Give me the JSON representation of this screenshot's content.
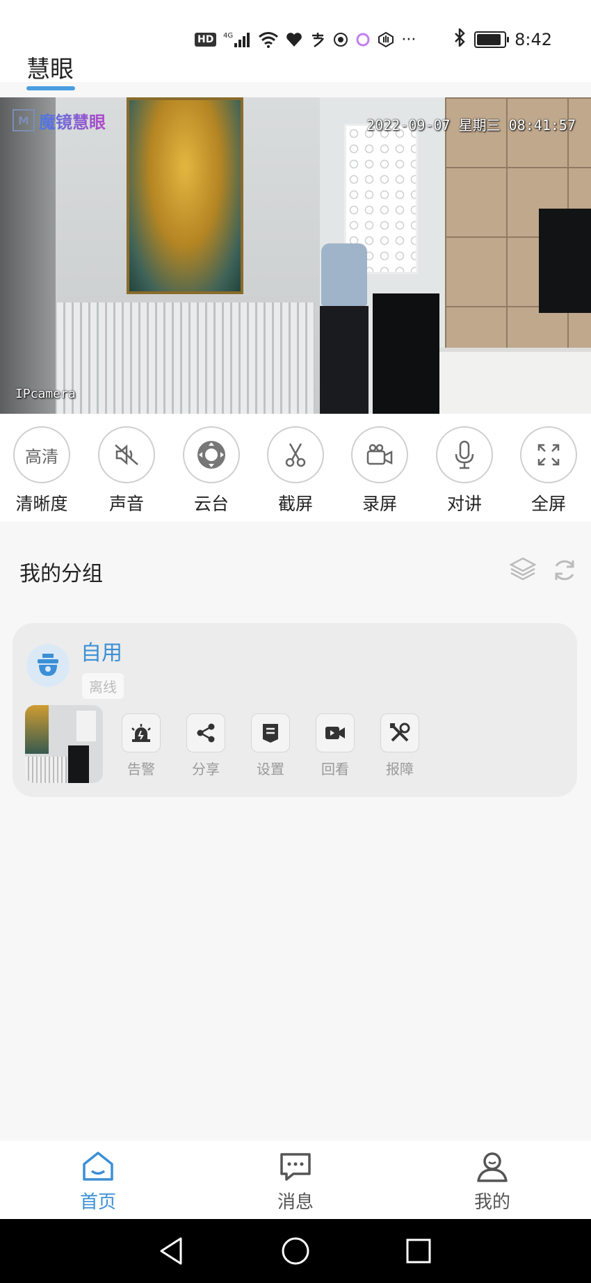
{
  "status_bar": {
    "left_icons": [
      "hd-icon",
      "4g-signal-icon",
      "wifi-icon",
      "health-icon",
      "alipay-icon",
      "sf-icon",
      "circle-app-icon",
      "gesture-icon",
      "more-dots-icon"
    ],
    "hd_label": "HD",
    "network_label": "4G",
    "more_label": "···",
    "time": "8:42",
    "battery_level": 0.9
  },
  "header": {
    "title": "慧眼"
  },
  "camera": {
    "logo_text": "魔镜慧眼",
    "logo_mark": "M",
    "timestamp": "2022-09-07 星期三 08:41:57",
    "label": "IPcamera"
  },
  "controls": [
    {
      "name": "clarity",
      "icon_text": "高清",
      "label": "清晰度"
    },
    {
      "name": "sound",
      "icon": "mute-icon",
      "label": "声音"
    },
    {
      "name": "ptz",
      "icon": "ptz-icon",
      "label": "云台"
    },
    {
      "name": "screenshot",
      "icon": "scissors-icon",
      "label": "截屏"
    },
    {
      "name": "record",
      "icon": "video-camera-icon",
      "label": "录屏"
    },
    {
      "name": "intercom",
      "icon": "microphone-icon",
      "label": "对讲"
    },
    {
      "name": "fullscreen",
      "icon": "fullscreen-icon",
      "label": "全屏"
    }
  ],
  "group": {
    "header": "我的分组",
    "device": {
      "name": "自用",
      "status": "离线",
      "actions": [
        {
          "name": "alarm",
          "icon": "siren-icon",
          "label": "告警"
        },
        {
          "name": "share",
          "icon": "share-icon",
          "label": "分享"
        },
        {
          "name": "settings",
          "icon": "settings-doc-icon",
          "label": "设置"
        },
        {
          "name": "playback",
          "icon": "playback-icon",
          "label": "回看"
        },
        {
          "name": "report",
          "icon": "tools-icon",
          "label": "报障"
        }
      ]
    }
  },
  "bottom_nav": [
    {
      "name": "home",
      "icon": "home-icon",
      "label": "首页",
      "active": true
    },
    {
      "name": "messages",
      "icon": "message-icon",
      "label": "消息",
      "active": false
    },
    {
      "name": "mine",
      "icon": "profile-icon",
      "label": "我的",
      "active": false
    }
  ],
  "colors": {
    "accent": "#3b8fd6",
    "underline": "#4a9ee0",
    "background": "#f7f7f7"
  }
}
